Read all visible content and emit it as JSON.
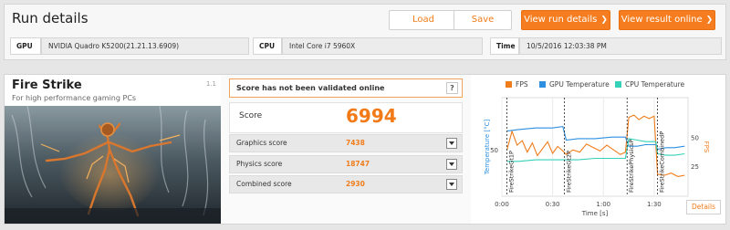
{
  "run_details": {
    "title": "Run details",
    "buttons": {
      "load": "Load",
      "save": "Save",
      "view_run_details": "View run details",
      "view_result_online": "View result online"
    },
    "info": {
      "gpu_label": "GPU",
      "gpu_value": "NVIDIA Quadro K5200(21.21.13.6909)",
      "cpu_label": "CPU",
      "cpu_value": "Intel Core i7 5960X",
      "time_label": "Time",
      "time_value": "10/5/2016 12:03:38 PM"
    }
  },
  "benchmark": {
    "title": "Fire Strike",
    "subtitle": "For high performance gaming PCs",
    "version": "1.1",
    "validation_text": "Score has not been validated online",
    "help": "?",
    "score_label": "Score",
    "score_value": "6994",
    "sub_scores": [
      {
        "label": "Graphics score",
        "value": "7438"
      },
      {
        "label": "Physics score",
        "value": "18747"
      },
      {
        "label": "Combined score",
        "value": "2930"
      }
    ],
    "details_button": "Details"
  },
  "chart_data": {
    "type": "line",
    "legend": [
      {
        "name": "FPS",
        "color": "#f07c1a"
      },
      {
        "name": "GPU Temperature",
        "color": "#2e8fe0"
      },
      {
        "name": "CPU Temperature",
        "color": "#35d1b8"
      }
    ],
    "xlabel": "Time [s]",
    "x_ticks": [
      "0:00",
      "0:30",
      "1:00",
      "1:30"
    ],
    "x_tick_values": [
      0,
      30,
      60,
      90
    ],
    "xlim": [
      0,
      110
    ],
    "ylabel_left": "Temperature [°C]",
    "ylabel_right": "FPS",
    "y_left_ticks": [
      50
    ],
    "y_left_lim": [
      20,
      85
    ],
    "y_right_ticks": [
      25,
      50
    ],
    "y_right_lim": [
      0,
      85
    ],
    "phase_markers": [
      {
        "x": 3,
        "label": "FireStrikeGt1P"
      },
      {
        "x": 37,
        "label": "FireStrikeGt2P"
      },
      {
        "x": 74,
        "label": "FireStrikePhysicsP"
      },
      {
        "x": 92,
        "label": "FireStrikeCombinedP"
      }
    ],
    "series": [
      {
        "name": "FPS",
        "x": [
          3,
          6,
          9,
          12,
          15,
          18,
          21,
          24,
          27,
          30,
          33,
          36,
          38,
          42,
          46,
          50,
          54,
          58,
          62,
          66,
          70,
          73,
          75,
          78,
          81,
          84,
          87,
          90,
          92,
          96,
          100,
          104,
          108
        ],
        "values": [
          40,
          56,
          44,
          48,
          38,
          46,
          35,
          41,
          47,
          37,
          43,
          39,
          36,
          40,
          38,
          45,
          42,
          39,
          44,
          40,
          36,
          38,
          68,
          70,
          66,
          69,
          67,
          69,
          19,
          18,
          20,
          17,
          18
        ]
      },
      {
        "name": "GPU Temperature",
        "x": [
          3,
          10,
          20,
          30,
          36,
          38,
          45,
          55,
          65,
          73,
          75,
          80,
          85,
          91,
          92,
          97,
          102,
          108
        ],
        "values": [
          63,
          64,
          65,
          65,
          66,
          57,
          58,
          58,
          59,
          59,
          53,
          53,
          54,
          54,
          51,
          52,
          52,
          53
        ]
      },
      {
        "name": "CPU Temperature",
        "x": [
          3,
          10,
          20,
          30,
          36,
          38,
          45,
          55,
          65,
          73,
          75,
          80,
          85,
          91,
          92,
          97,
          102,
          108
        ],
        "values": [
          43,
          43,
          44,
          44,
          44,
          44,
          44,
          45,
          45,
          45,
          58,
          57,
          56,
          56,
          48,
          47,
          47,
          48
        ]
      }
    ]
  }
}
